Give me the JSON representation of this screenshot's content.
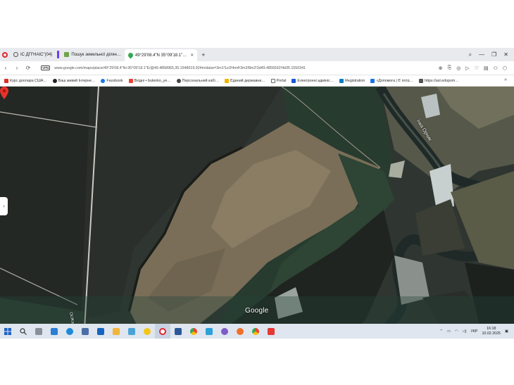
{
  "tabs": [
    {
      "label": "ІС ДП\"НАІС\"(04)",
      "active": false
    },
    {
      "label": "Пошук земельної ділян…",
      "active": false
    },
    {
      "label": "49°29'08.4\"N 35°09'18.1\"…",
      "active": true
    }
  ],
  "new_tab_label": "+",
  "window_controls": {
    "search": "⌕",
    "minimize": "—",
    "restore": "❐",
    "close": "✕"
  },
  "nav": {
    "back": "‹",
    "forward": "›",
    "reload": "⟳"
  },
  "vpn_label": "VPN",
  "url": "www.google.com/maps/place/49°29'08.4\"N+35°09'18.1\"E/@49.4858965,35.1548019,924m/data=!3m1!1e3!4m4!3m3!8m2!3d49.4856592!4d35.1550341",
  "bookmarks": [
    {
      "label": "Курс доллара США…",
      "color": "#d93025"
    },
    {
      "label": "Ваш живий Інтерне…",
      "color": "#222222"
    },
    {
      "label": "Facebook",
      "color": "#1877f2"
    },
    {
      "label": "Вхідні • butenko_ye…",
      "color": "#ea4335"
    },
    {
      "label": "Персональний кабі…",
      "color": "#444444"
    },
    {
      "label": "Єдиний державни…",
      "color": "#f4b400"
    },
    {
      "label": "Portal",
      "color": "#666666"
    },
    {
      "label": "Електронні адмініс…",
      "color": "#1a56db"
    },
    {
      "label": "Registration",
      "color": "#0a7ec2"
    },
    {
      "label": "«Допомога | Є потр…",
      "color": "#1a73e8"
    },
    {
      "label": "https://asl.edopom…",
      "color": "#555555"
    }
  ],
  "bookmarks_more": "»",
  "map": {
    "google_logo": "Google",
    "river_label": "ічка Орчик",
    "road_label": "ОсЖаз",
    "side_handle": "›"
  },
  "taskbar": {
    "apps": [
      "start",
      "search",
      "widgets",
      "task-view",
      "edge",
      "store",
      "mail",
      "explorer",
      "notepad",
      "python",
      "opera",
      "word",
      "chrome",
      "telegram",
      "viber",
      "firefox",
      "chrome-2",
      "anydesk"
    ],
    "lang": "УКР",
    "time": "16:18",
    "date": "10.02.2025"
  },
  "colors": {
    "pin": "#e8332a",
    "tab_accent": "#6b3df0",
    "opera": "#e1262d"
  }
}
